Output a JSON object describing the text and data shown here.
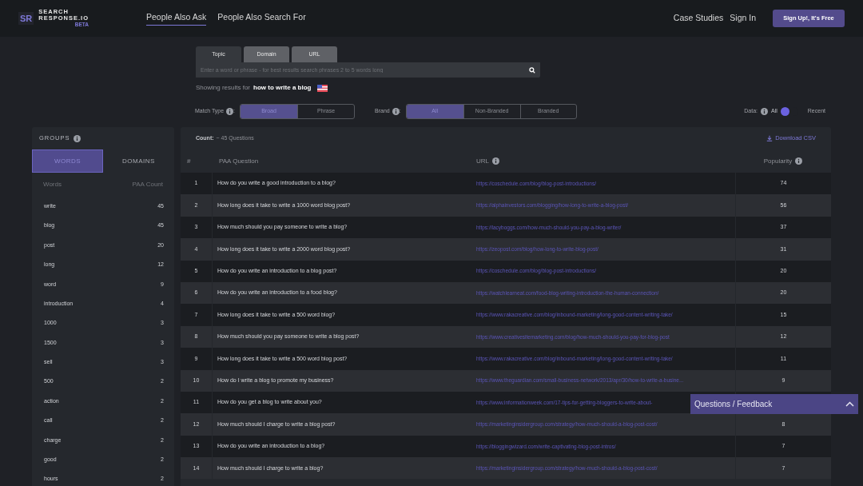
{
  "header": {
    "logo_mark": "SR",
    "logo_name": [
      "SEARCH",
      "RESPONSE.IO"
    ],
    "logo_badge": "BETA",
    "nav": [
      {
        "label": "People Also Ask",
        "selected": true
      },
      {
        "label": "People Also Search For",
        "selected": false
      }
    ],
    "links": [
      "Case Studies",
      "Sign In"
    ],
    "cta": "Sign Up!, It's Free"
  },
  "search": {
    "tabs": [
      {
        "label": "Topic",
        "selected": true
      },
      {
        "label": "Domain",
        "selected": false
      },
      {
        "label": "URL",
        "selected": false
      }
    ],
    "placeholder": "Enter a word or phrase - for best results search phrases 2 to 5 words long",
    "results_prefix": "Showing results for",
    "query": "how to write a blog"
  },
  "filters": {
    "match_type": {
      "label": "Match Type",
      "separator": ":",
      "options": [
        {
          "label": "Broad",
          "selected": true
        },
        {
          "label": "Phrase",
          "selected": false
        }
      ]
    },
    "brand": {
      "label": "Brand",
      "separator": ":",
      "options": [
        {
          "label": "All",
          "selected": true
        },
        {
          "label": "Non-Branded",
          "selected": false
        },
        {
          "label": "Branded",
          "selected": false
        }
      ]
    },
    "data": {
      "label": "Data:",
      "left": "All",
      "right": "Recent",
      "recent_on": false
    }
  },
  "groups": {
    "title": "GROUPS",
    "tabs": [
      {
        "label": "WORDS",
        "selected": true
      },
      {
        "label": "DOMAINS",
        "selected": false
      }
    ],
    "columns": [
      "Words",
      "PAA Count"
    ],
    "rows": [
      [
        "write",
        "45"
      ],
      [
        "blog",
        "45"
      ],
      [
        "post",
        "20"
      ],
      [
        "long",
        "12"
      ],
      [
        "word",
        "9"
      ],
      [
        "introduction",
        "4"
      ],
      [
        "1000",
        "3"
      ],
      [
        "1500",
        "3"
      ],
      [
        "sell",
        "3"
      ],
      [
        "500",
        "2"
      ],
      [
        "action",
        "2"
      ],
      [
        "call",
        "2"
      ],
      [
        "charge",
        "2"
      ],
      [
        "good",
        "2"
      ],
      [
        "hours",
        "2"
      ]
    ]
  },
  "results": {
    "count_label": "Count:",
    "count_value": "~ 45 Questions",
    "download": "Download CSV",
    "columns": [
      "#",
      "PAA Question",
      "URL",
      "Popularity"
    ],
    "rows": [
      [
        "1",
        "How do you write a good introduction to a blog?",
        "https://coschedule.com/blog/blog-post-introductions/",
        "74"
      ],
      [
        "2",
        "How long does it take to write a 1000 word blog post?",
        "https://alphainvestors.com/blogging/how-long-to-write-a-blog-post/",
        "56"
      ],
      [
        "3",
        "How much should you pay someone to write a blog?",
        "https://lacyboggs.com/how-much-should-you-pay-a-blog-writer/",
        "37"
      ],
      [
        "4",
        "How long does it take to write a 2000 word blog post?",
        "https://zeopost.com/blog/how-long-to-write-blog-post/",
        "31"
      ],
      [
        "5",
        "How do you write an introduction to a blog post?",
        "https://coschedule.com/blog/blog-post-introductions/",
        "20"
      ],
      [
        "6",
        "How do you write an introduction to a food blog?",
        "https://watchlearneat.com/food-blog-writing-introduction-the-human-connection/",
        "20"
      ],
      [
        "7",
        "How long does it take to write a 500 word blog?",
        "https://www.rakacreative.com/blog/inbound-marketing/long-good-content-writing-take/",
        "15"
      ],
      [
        "8",
        "How much should you pay someone to write a blog post?",
        "https://www.creativesitemarketing.com/blog/how-much-should-you-pay-for-blog-post",
        "12"
      ],
      [
        "9",
        "How long does it take to write a 500 word blog post?",
        "https://www.rakacreative.com/blog/inbound-marketing/long-good-content-writing-take/",
        "11"
      ],
      [
        "10",
        "How do I write a blog to promote my business?",
        "https://www.theguardian.com/small-business-network/2013/apr/30/how-to-write-a-busine...",
        "9"
      ],
      [
        "11",
        "How do you get a blog to write about you?",
        "https://www.informationweek.com/17-tips-for-getting-bloggers-to-write-about-",
        ""
      ],
      [
        "12",
        "How much should I charge to write a blog post?",
        "https://marketinginsidergroup.com/strategy/how-much-should-a-blog-post-cost/",
        "8"
      ],
      [
        "13",
        "How do you write an introduction to a blog?",
        "https://bloggingwizard.com/write-captivating-blog-post-intros/",
        "7"
      ],
      [
        "14",
        "How much should I charge to write a blog?",
        "https://marketinginsidergroup.com/strategy/how-much-should-a-blog-post-cost/",
        "7"
      ]
    ]
  },
  "feedback": {
    "label": "Questions / Feedback",
    "expanded": false
  }
}
